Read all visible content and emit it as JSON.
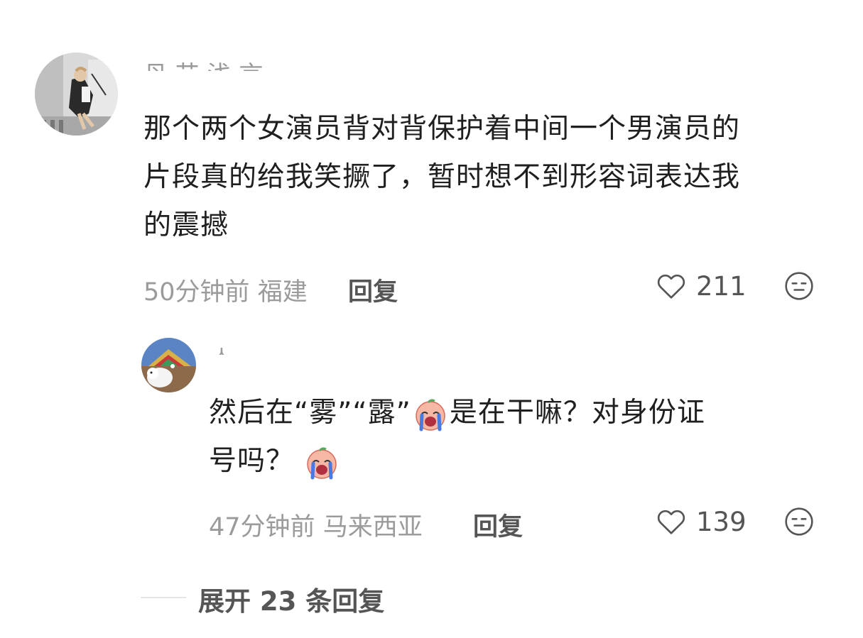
{
  "comment": {
    "author_partial": "丹 艺 浅 言 ...",
    "text_lines": [
      "那个两个女演员背对背保护着中间一个男演员的",
      "片段真的给我笑撅了，暂时想不到形容词表达我",
      "的震撼"
    ],
    "time": "50分钟前",
    "location": "福建",
    "reply_label": "回复",
    "likes": "211",
    "heart_icon": "heart-outline-icon",
    "dislike_icon": "meh-face-icon"
  },
  "reply": {
    "author_partial": "ㅅ",
    "text_line1_part1": "然后在“雾”“露”",
    "text_line1_part2": "是在干嘛？对身份证",
    "text_line2": "号吗？",
    "emoji": "crying-emoji-icon",
    "time": "47分钟前",
    "location": "马来西亚",
    "reply_label": "回复",
    "likes": "139",
    "heart_icon": "heart-outline-icon",
    "dislike_icon": "meh-face-icon"
  },
  "expand": {
    "label": "展开 23 条回复"
  }
}
